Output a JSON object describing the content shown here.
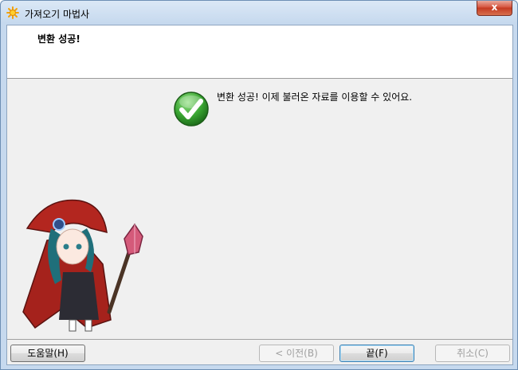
{
  "window": {
    "title": "가져오기 마법사",
    "close_label": "x"
  },
  "header": {
    "title": "변환 성공!"
  },
  "main": {
    "message": "변환 성공! 이제 불러온 자료를 이용할 수 있어요."
  },
  "footer": {
    "help_label": "도움말(H)",
    "back_label": "< 이전(B)",
    "finish_label": "끝(F)",
    "cancel_label": "취소(C)"
  },
  "icons": {
    "title": "sun-wizard-icon",
    "success": "green-check-icon",
    "mascot": "wizard-girl-illustration"
  },
  "colors": {
    "success_green": "#3aa632",
    "close_red": "#c43a22",
    "mascot_red": "#a5221c"
  }
}
